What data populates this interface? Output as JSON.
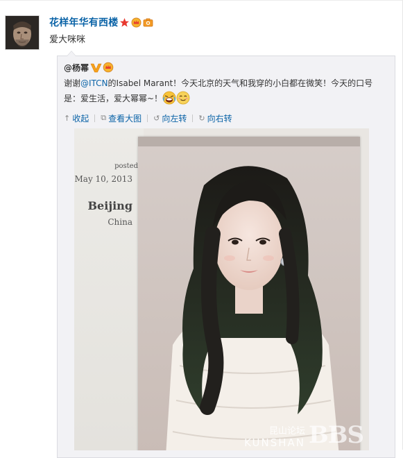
{
  "post": {
    "author": "花样年华有西楼",
    "text": "爱大咪咪",
    "badges": [
      "vip-star-icon",
      "crown-icon",
      "camera-icon"
    ]
  },
  "repost": {
    "author": "@杨幂",
    "verified_badge": "verified-v-icon",
    "text_before_mention": "谢谢",
    "mention": "@ITCN",
    "text_after_mention": "的Isabel Marant！今天北京的天气和我穿的小白都在微笑！今天的口号是：爱生活，爱大幂幂~！",
    "emojis": [
      "laughing-cry-emoji-icon",
      "content-smile-emoji-icon"
    ]
  },
  "toolbar": {
    "collapse_label": "收起",
    "view_large_label": "查看大图",
    "rotate_left_label": "向左转",
    "rotate_right_label": "向右转"
  },
  "image": {
    "posted_label": "posted",
    "date": "May 10, 2013",
    "city": "Beijing",
    "country": "China",
    "watermark_cn": "昆山论坛",
    "watermark_en": "KUNSHAN",
    "watermark_logo": "BBS"
  },
  "colors": {
    "link": "#0a63a7",
    "repost_bg": "#f2f2f5",
    "repost_border": "#dadbe0"
  }
}
